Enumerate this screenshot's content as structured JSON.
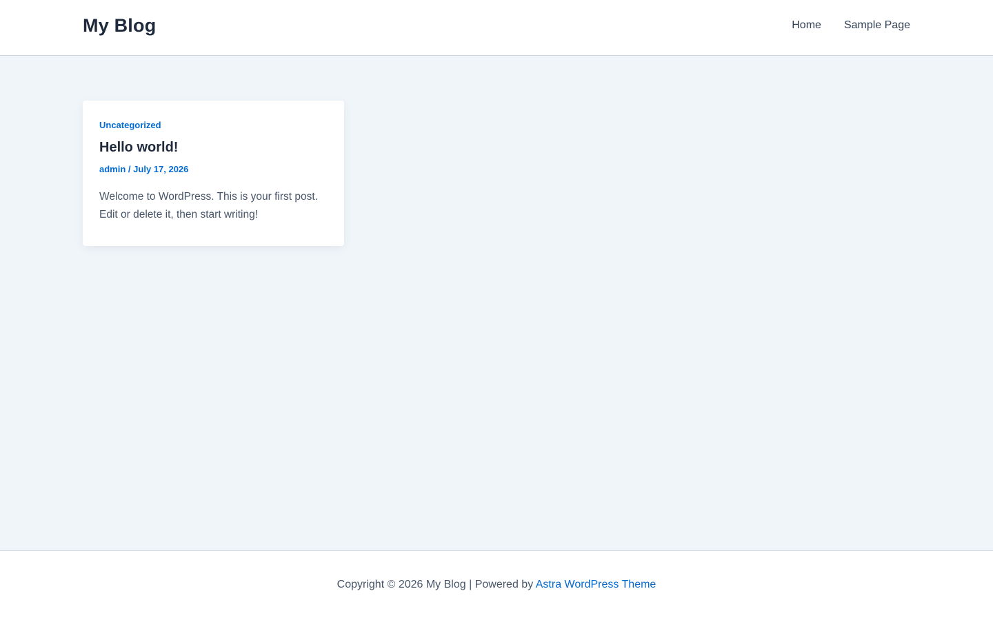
{
  "header": {
    "site_title": "My Blog",
    "nav": [
      {
        "label": "Home"
      },
      {
        "label": "Sample Page"
      }
    ]
  },
  "post": {
    "category": "Uncategorized",
    "title": "Hello world!",
    "author": "admin",
    "separator": "/",
    "date": "July 17, 2026",
    "excerpt": "Welcome to WordPress. This is your first post. Edit or delete it, then start writing!"
  },
  "footer": {
    "copyright": "Copyright © 2026 My Blog | Powered by",
    "theme_link": "Astra WordPress Theme"
  },
  "colors": {
    "accent": "#046bd2",
    "background": "#f0f5fa",
    "heading": "#1e293b"
  }
}
